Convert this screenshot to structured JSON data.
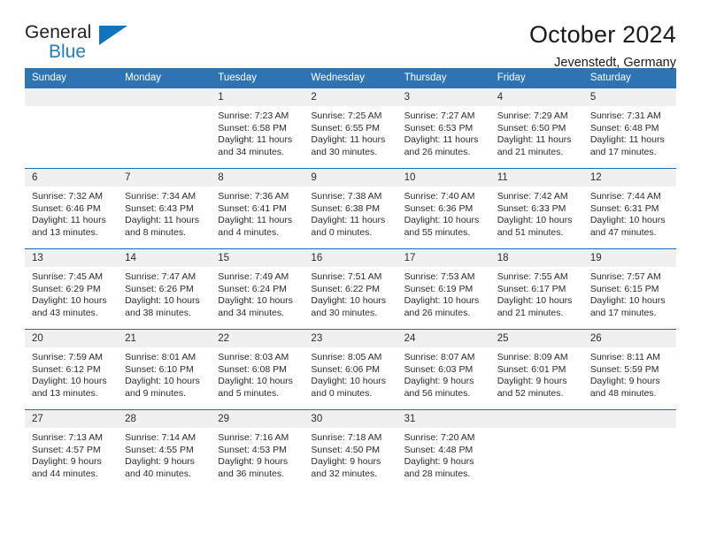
{
  "brand": {
    "name_part1": "General",
    "name_part2": "Blue",
    "logo_icon": "triangle-flag-icon",
    "accent_color": "#1274bb"
  },
  "header": {
    "title": "October 2024",
    "subtitle": "Jevenstedt, Germany"
  },
  "theme": {
    "header_bg": "#2e74b5",
    "daynum_bg": "#f0f0f0",
    "week_divider": "#1f6cb0",
    "text": "#2b2b2b"
  },
  "calendar": {
    "weekday_headers": [
      "Sunday",
      "Monday",
      "Tuesday",
      "Wednesday",
      "Thursday",
      "Friday",
      "Saturday"
    ],
    "weeks": [
      [
        {
          "day": "",
          "empty": true
        },
        {
          "day": "",
          "empty": true
        },
        {
          "day": "1",
          "sunrise": "Sunrise: 7:23 AM",
          "sunset": "Sunset: 6:58 PM",
          "daylight_1": "Daylight: 11 hours",
          "daylight_2": "and 34 minutes."
        },
        {
          "day": "2",
          "sunrise": "Sunrise: 7:25 AM",
          "sunset": "Sunset: 6:55 PM",
          "daylight_1": "Daylight: 11 hours",
          "daylight_2": "and 30 minutes."
        },
        {
          "day": "3",
          "sunrise": "Sunrise: 7:27 AM",
          "sunset": "Sunset: 6:53 PM",
          "daylight_1": "Daylight: 11 hours",
          "daylight_2": "and 26 minutes."
        },
        {
          "day": "4",
          "sunrise": "Sunrise: 7:29 AM",
          "sunset": "Sunset: 6:50 PM",
          "daylight_1": "Daylight: 11 hours",
          "daylight_2": "and 21 minutes."
        },
        {
          "day": "5",
          "sunrise": "Sunrise: 7:31 AM",
          "sunset": "Sunset: 6:48 PM",
          "daylight_1": "Daylight: 11 hours",
          "daylight_2": "and 17 minutes."
        }
      ],
      [
        {
          "day": "6",
          "sunrise": "Sunrise: 7:32 AM",
          "sunset": "Sunset: 6:46 PM",
          "daylight_1": "Daylight: 11 hours",
          "daylight_2": "and 13 minutes."
        },
        {
          "day": "7",
          "sunrise": "Sunrise: 7:34 AM",
          "sunset": "Sunset: 6:43 PM",
          "daylight_1": "Daylight: 11 hours",
          "daylight_2": "and 8 minutes."
        },
        {
          "day": "8",
          "sunrise": "Sunrise: 7:36 AM",
          "sunset": "Sunset: 6:41 PM",
          "daylight_1": "Daylight: 11 hours",
          "daylight_2": "and 4 minutes."
        },
        {
          "day": "9",
          "sunrise": "Sunrise: 7:38 AM",
          "sunset": "Sunset: 6:38 PM",
          "daylight_1": "Daylight: 11 hours",
          "daylight_2": "and 0 minutes."
        },
        {
          "day": "10",
          "sunrise": "Sunrise: 7:40 AM",
          "sunset": "Sunset: 6:36 PM",
          "daylight_1": "Daylight: 10 hours",
          "daylight_2": "and 55 minutes."
        },
        {
          "day": "11",
          "sunrise": "Sunrise: 7:42 AM",
          "sunset": "Sunset: 6:33 PM",
          "daylight_1": "Daylight: 10 hours",
          "daylight_2": "and 51 minutes."
        },
        {
          "day": "12",
          "sunrise": "Sunrise: 7:44 AM",
          "sunset": "Sunset: 6:31 PM",
          "daylight_1": "Daylight: 10 hours",
          "daylight_2": "and 47 minutes."
        }
      ],
      [
        {
          "day": "13",
          "sunrise": "Sunrise: 7:45 AM",
          "sunset": "Sunset: 6:29 PM",
          "daylight_1": "Daylight: 10 hours",
          "daylight_2": "and 43 minutes."
        },
        {
          "day": "14",
          "sunrise": "Sunrise: 7:47 AM",
          "sunset": "Sunset: 6:26 PM",
          "daylight_1": "Daylight: 10 hours",
          "daylight_2": "and 38 minutes."
        },
        {
          "day": "15",
          "sunrise": "Sunrise: 7:49 AM",
          "sunset": "Sunset: 6:24 PM",
          "daylight_1": "Daylight: 10 hours",
          "daylight_2": "and 34 minutes."
        },
        {
          "day": "16",
          "sunrise": "Sunrise: 7:51 AM",
          "sunset": "Sunset: 6:22 PM",
          "daylight_1": "Daylight: 10 hours",
          "daylight_2": "and 30 minutes."
        },
        {
          "day": "17",
          "sunrise": "Sunrise: 7:53 AM",
          "sunset": "Sunset: 6:19 PM",
          "daylight_1": "Daylight: 10 hours",
          "daylight_2": "and 26 minutes."
        },
        {
          "day": "18",
          "sunrise": "Sunrise: 7:55 AM",
          "sunset": "Sunset: 6:17 PM",
          "daylight_1": "Daylight: 10 hours",
          "daylight_2": "and 21 minutes."
        },
        {
          "day": "19",
          "sunrise": "Sunrise: 7:57 AM",
          "sunset": "Sunset: 6:15 PM",
          "daylight_1": "Daylight: 10 hours",
          "daylight_2": "and 17 minutes."
        }
      ],
      [
        {
          "day": "20",
          "sunrise": "Sunrise: 7:59 AM",
          "sunset": "Sunset: 6:12 PM",
          "daylight_1": "Daylight: 10 hours",
          "daylight_2": "and 13 minutes."
        },
        {
          "day": "21",
          "sunrise": "Sunrise: 8:01 AM",
          "sunset": "Sunset: 6:10 PM",
          "daylight_1": "Daylight: 10 hours",
          "daylight_2": "and 9 minutes."
        },
        {
          "day": "22",
          "sunrise": "Sunrise: 8:03 AM",
          "sunset": "Sunset: 6:08 PM",
          "daylight_1": "Daylight: 10 hours",
          "daylight_2": "and 5 minutes."
        },
        {
          "day": "23",
          "sunrise": "Sunrise: 8:05 AM",
          "sunset": "Sunset: 6:06 PM",
          "daylight_1": "Daylight: 10 hours",
          "daylight_2": "and 0 minutes."
        },
        {
          "day": "24",
          "sunrise": "Sunrise: 8:07 AM",
          "sunset": "Sunset: 6:03 PM",
          "daylight_1": "Daylight: 9 hours",
          "daylight_2": "and 56 minutes."
        },
        {
          "day": "25",
          "sunrise": "Sunrise: 8:09 AM",
          "sunset": "Sunset: 6:01 PM",
          "daylight_1": "Daylight: 9 hours",
          "daylight_2": "and 52 minutes."
        },
        {
          "day": "26",
          "sunrise": "Sunrise: 8:11 AM",
          "sunset": "Sunset: 5:59 PM",
          "daylight_1": "Daylight: 9 hours",
          "daylight_2": "and 48 minutes."
        }
      ],
      [
        {
          "day": "27",
          "sunrise": "Sunrise: 7:13 AM",
          "sunset": "Sunset: 4:57 PM",
          "daylight_1": "Daylight: 9 hours",
          "daylight_2": "and 44 minutes."
        },
        {
          "day": "28",
          "sunrise": "Sunrise: 7:14 AM",
          "sunset": "Sunset: 4:55 PM",
          "daylight_1": "Daylight: 9 hours",
          "daylight_2": "and 40 minutes."
        },
        {
          "day": "29",
          "sunrise": "Sunrise: 7:16 AM",
          "sunset": "Sunset: 4:53 PM",
          "daylight_1": "Daylight: 9 hours",
          "daylight_2": "and 36 minutes."
        },
        {
          "day": "30",
          "sunrise": "Sunrise: 7:18 AM",
          "sunset": "Sunset: 4:50 PM",
          "daylight_1": "Daylight: 9 hours",
          "daylight_2": "and 32 minutes."
        },
        {
          "day": "31",
          "sunrise": "Sunrise: 7:20 AM",
          "sunset": "Sunset: 4:48 PM",
          "daylight_1": "Daylight: 9 hours",
          "daylight_2": "and 28 minutes."
        },
        {
          "day": "",
          "empty": true
        },
        {
          "day": "",
          "empty": true
        }
      ]
    ]
  }
}
